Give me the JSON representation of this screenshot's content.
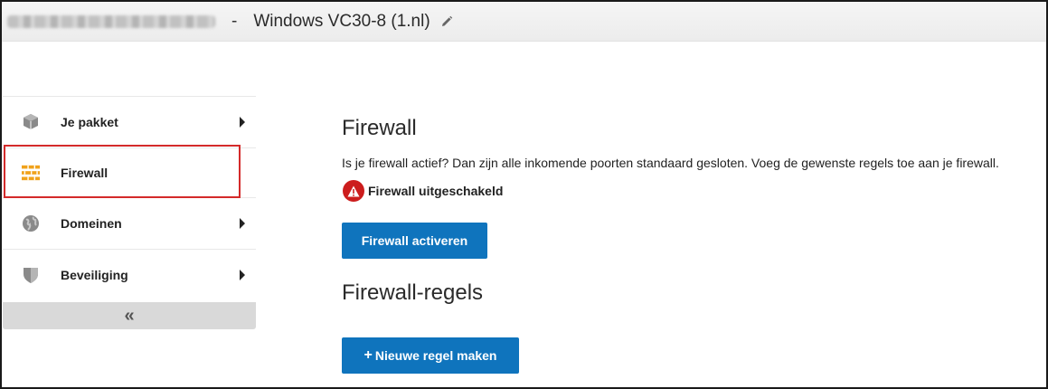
{
  "header": {
    "separator": "-",
    "title": "Windows VC30-8 (1.nl)"
  },
  "sidebar": {
    "items": [
      {
        "label": "Je pakket",
        "icon": "package-icon"
      },
      {
        "label": "Firewall",
        "icon": "firewall-icon"
      },
      {
        "label": "Domeinen",
        "icon": "globe-icon"
      },
      {
        "label": "Beveiliging",
        "icon": "shield-icon"
      }
    ],
    "collapse_label": "«"
  },
  "main": {
    "title": "Firewall",
    "description": "Is je firewall actief? Dan zijn alle inkomende poorten standaard gesloten. Voeg de gewenste regels toe aan je firewall.",
    "status_text": "Firewall uitgeschakeld",
    "activate_button": "Firewall activeren",
    "rules_title": "Firewall-regels",
    "new_rule_button": "Nieuwe regel maken",
    "new_rule_icon": "+"
  },
  "colors": {
    "primary": "#0f74bd",
    "danger": "#cc1d1d",
    "highlight_border": "#d42a2a",
    "firewall_icon": "#f0a21b"
  }
}
